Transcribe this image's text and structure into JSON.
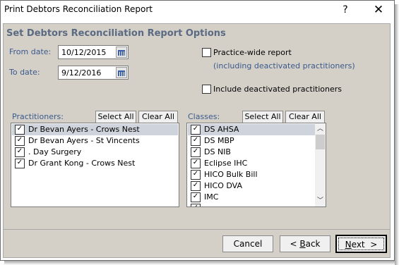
{
  "window": {
    "title": "Print Debtors Reconciliation Report",
    "help_glyph": "?",
    "close_glyph": "✕"
  },
  "heading": "Set Debtors Reconciliation Report Options",
  "dates": {
    "from_label": "From date:",
    "from_value": "10/12/2015",
    "to_label": "To date:",
    "to_value": "9/12/2016"
  },
  "options": {
    "practice_wide_label": "Practice-wide report",
    "practice_wide_hint": "(including deactivated practitioners)",
    "practice_wide_checked": false,
    "include_deactivated_label": "Include deactivated practitioners",
    "include_deactivated_checked": false
  },
  "practitioners": {
    "label": "Practitioners:",
    "select_all": "Select All",
    "clear_all": "Clear All",
    "items": [
      {
        "name": "Dr Bevan Ayers - Crows Nest",
        "checked": true,
        "selected": true
      },
      {
        "name": "Dr Bevan Ayers - St Vincents",
        "checked": true,
        "selected": false
      },
      {
        "name": ". Day Surgery",
        "checked": true,
        "selected": false
      },
      {
        "name": "Dr Grant Kong - Crows Nest",
        "checked": true,
        "selected": false
      }
    ]
  },
  "classes": {
    "label": "Classes:",
    "select_all": "Select All",
    "clear_all": "Clear All",
    "items": [
      {
        "name": "DS AHSA",
        "checked": true,
        "selected": true
      },
      {
        "name": "DS MBP",
        "checked": true,
        "selected": false
      },
      {
        "name": "DS NIB",
        "checked": true,
        "selected": false
      },
      {
        "name": "Eclipse IHC",
        "checked": true,
        "selected": false
      },
      {
        "name": "HICO Bulk Bill",
        "checked": true,
        "selected": false
      },
      {
        "name": "HICO DVA",
        "checked": true,
        "selected": false
      },
      {
        "name": "IMC",
        "checked": true,
        "selected": false
      },
      {
        "name": "",
        "checked": true,
        "selected": false
      }
    ]
  },
  "footer": {
    "cancel": "Cancel",
    "back_prefix": "< ",
    "back_hotkey": "B",
    "back_rest": "ack",
    "next_hotkey": "N",
    "next_rest": "ext  >"
  },
  "colors": {
    "panel": "#d4d0c8",
    "accent_text": "#3a5a8c",
    "selection": "#cfd3dc"
  }
}
